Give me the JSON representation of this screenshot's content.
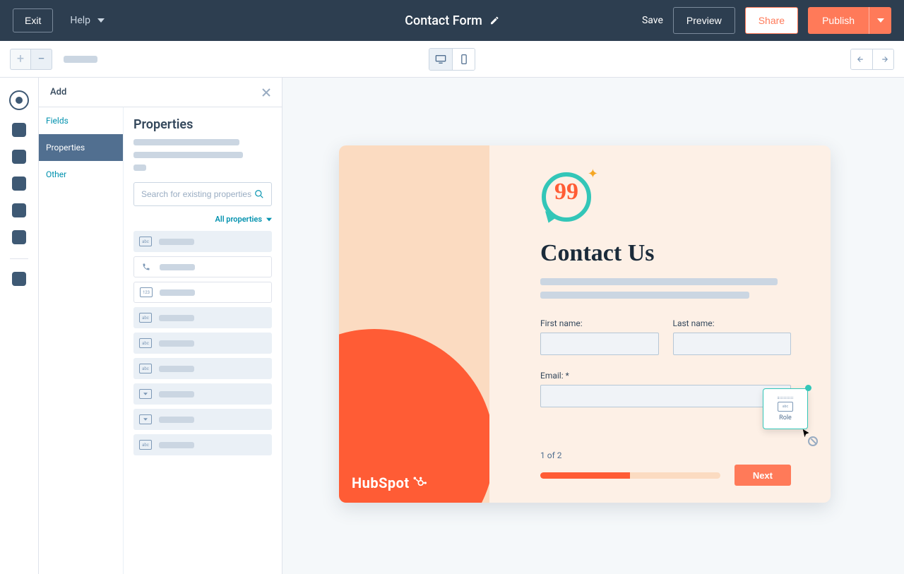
{
  "topnav": {
    "exit": "Exit",
    "help": "Help",
    "title": "Contact Form",
    "save": "Save",
    "preview": "Preview",
    "share": "Share",
    "publish": "Publish"
  },
  "panel": {
    "add": "Add",
    "categories": {
      "fields": "Fields",
      "properties": "Properties",
      "other": "Other"
    },
    "active_category": "Properties",
    "title": "Properties",
    "search_placeholder": "Search for existing properties",
    "all_properties": "All properties",
    "items": [
      {
        "type": "text"
      },
      {
        "type": "phone"
      },
      {
        "type": "number"
      },
      {
        "type": "text"
      },
      {
        "type": "text"
      },
      {
        "type": "text"
      },
      {
        "type": "dropdown"
      },
      {
        "type": "dropdown"
      },
      {
        "type": "text"
      }
    ]
  },
  "form": {
    "heading": "Contact Us",
    "fields": {
      "first_name": "First name:",
      "last_name": "Last name:",
      "email": "Email: *"
    },
    "drag_label": "Role",
    "step_text": "1 of 2",
    "next": "Next",
    "brand": "HubSpot"
  }
}
